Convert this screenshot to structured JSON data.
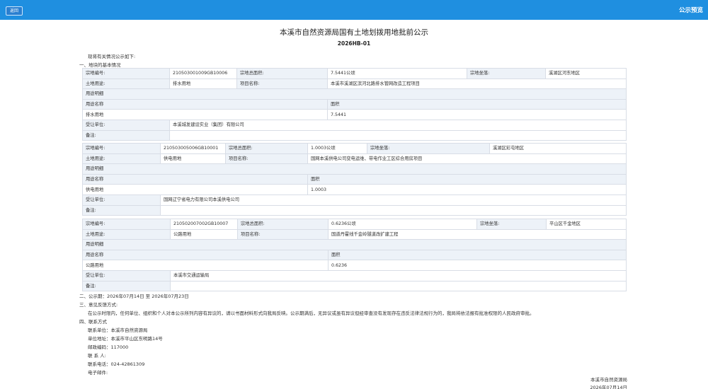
{
  "topbar": {
    "close_label": "返回",
    "title": "公示预览"
  },
  "doc": {
    "title": "本溪市自然资源局国有土地划拨用地批前公示",
    "number": "2026HB-01"
  },
  "intro": "现将有关情况公示如下:",
  "section1": "一、地块的基本情况",
  "labels": {
    "code": "宗地编号:",
    "area": "宗地总面积:",
    "location": "宗地坐落:",
    "use": "土地用途:",
    "project": "项目名称:",
    "detail": "用途明细",
    "use_name": "用途名称",
    "size": "面积",
    "holder": "受让单位:",
    "remark": "备注:"
  },
  "parcels": [
    {
      "code": "210503001009GB10006",
      "area": "7.5441公顷",
      "location": "溪湖区河东地区",
      "use": "排水用地",
      "project": "本溪市溪湖区滨河北路排水管网改造工程项目",
      "detail_name": "排水用地",
      "detail_area": "7.5441",
      "holder": "本溪城发建设实业（集团）有限公司",
      "remark": ""
    },
    {
      "code": "210503005006GB10001",
      "area": "1.0003公顷",
      "location": "溪湖区彩屯地区",
      "use": "供电用地",
      "project": "国网本溪供电公司变电运维、带电作业工区综合用房项目",
      "detail_name": "供电用地",
      "detail_area": "1.0003",
      "holder": "国网辽宁省电力有限公司本溪供电公司",
      "remark": ""
    },
    {
      "code": "210502007002GB10007",
      "area": "0.6236公顷",
      "location": "平山区千金地区",
      "use": "公路用地",
      "project": "国道丹霍线千金岭隧道改扩建工程",
      "detail_name": "公路用地",
      "detail_area": "0.6236",
      "holder": "本溪市交通运输局",
      "remark": ""
    }
  ],
  "section2": "二、公示期：2026年07月14日 至 2026年07月23日",
  "section3": "三、意见反馈方式:",
  "feedback": "在公示时限内，任何单位、组织和个人对本公示所列内容有异议的，请以书面材料形式向我局反映。公示期满后，无异议或虽有异议但经审查没有发现存在违反法律法规行为的，我局将依法报有批准权限的人民政府审批。",
  "section4": "四、联系方式",
  "contact": {
    "unit": "联系单位：本溪市自然资源局",
    "address": "单位地址：本溪市平山区东明路14号",
    "postcode": "邮政编码：117000",
    "person": "联 系 人:",
    "phone": "联系电话：024-42861309",
    "email": "电子邮件:"
  },
  "footer": {
    "org": "本溪市自然资源局",
    "date": "2026年07月14日"
  }
}
